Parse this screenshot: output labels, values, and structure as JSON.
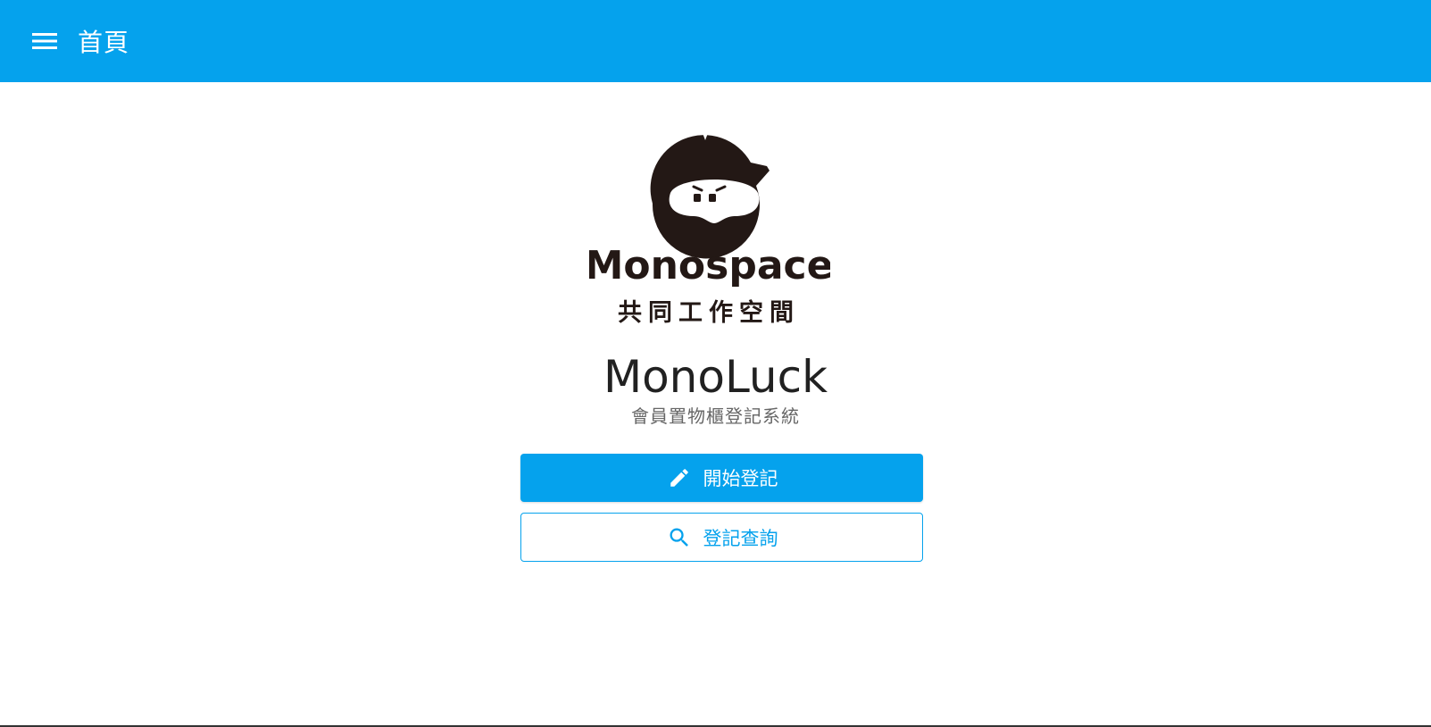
{
  "header": {
    "title": "首頁",
    "menu_icon": "hamburger-menu-icon",
    "background_color": "#05a2ed"
  },
  "logo": {
    "brand": "Monospace",
    "tagline": "共同工作空間"
  },
  "main": {
    "app_name": "MonoLuck",
    "subtitle": "會員置物櫃登記系統"
  },
  "actions": {
    "start_label": "開始登記",
    "start_icon": "pencil-icon",
    "query_label": "登記查詢",
    "query_icon": "search-icon",
    "accent_color": "#05a2ed"
  }
}
